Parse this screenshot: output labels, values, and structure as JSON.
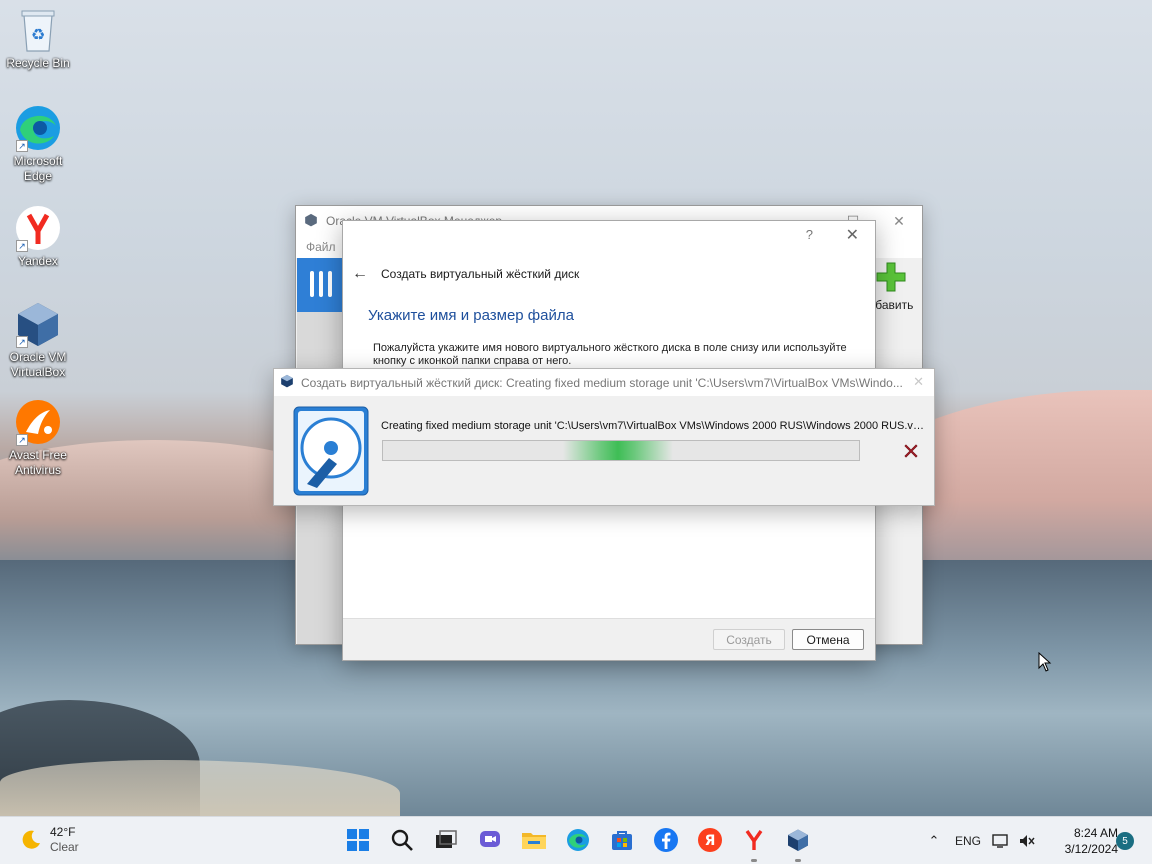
{
  "desktop": {
    "icons": [
      {
        "label": "Recycle Bin",
        "icon": "recycle-bin-icon"
      },
      {
        "label": "Microsoft Edge",
        "icon": "edge-icon"
      },
      {
        "label": "Yandex",
        "icon": "yandex-browser-icon"
      },
      {
        "label": "Oracle VM VirtualBox",
        "icon": "virtualbox-icon"
      },
      {
        "label": "Avast Free Antivirus",
        "icon": "avast-icon"
      }
    ]
  },
  "vbox_manager": {
    "title": "Oracle VM VirtualBox Менеджер",
    "menu_file": "Файл",
    "add_label": "обавить"
  },
  "wizard": {
    "help": "?",
    "close": "✕",
    "nav_title": "Создать виртуальный жёсткий диск",
    "heading": "Укажите имя и размер файла",
    "description": "Пожалуйста укажите имя нового виртуального жёсткого диска в поле снизу или используйте кнопку с иконкой папки справа от него.",
    "create_button": "Создать",
    "cancel_button": "Отмена"
  },
  "progress": {
    "title": "Создать виртуальный жёсткий диск: Creating fixed medium storage unit 'C:\\Users\\vm7\\VirtualBox VMs\\Windo...",
    "operation": "Creating fixed medium storage unit 'C:\\Users\\vm7\\VirtualBox VMs\\Windows 2000 RUS\\Windows 2000 RUS.vdi' ...",
    "state": "indeterminate"
  },
  "taskbar": {
    "weather_temp": "42°F",
    "weather_cond": "Clear",
    "apps": [
      "start-icon",
      "search-icon",
      "task-view-icon",
      "teams-chat-icon",
      "file-explorer-icon",
      "edge-icon",
      "store-icon",
      "facebook-icon",
      "yandex-icon",
      "yandex-browser-icon",
      "virtualbox-icon"
    ],
    "tray_chevron": "⌃",
    "language": "ENG",
    "time": "8:24 AM",
    "date": "3/12/2024",
    "notifications": "5"
  },
  "colors": {
    "accent": "#1e4f9c",
    "progress_green": "#06b025",
    "taskbar_bg": "#eef1f5"
  }
}
